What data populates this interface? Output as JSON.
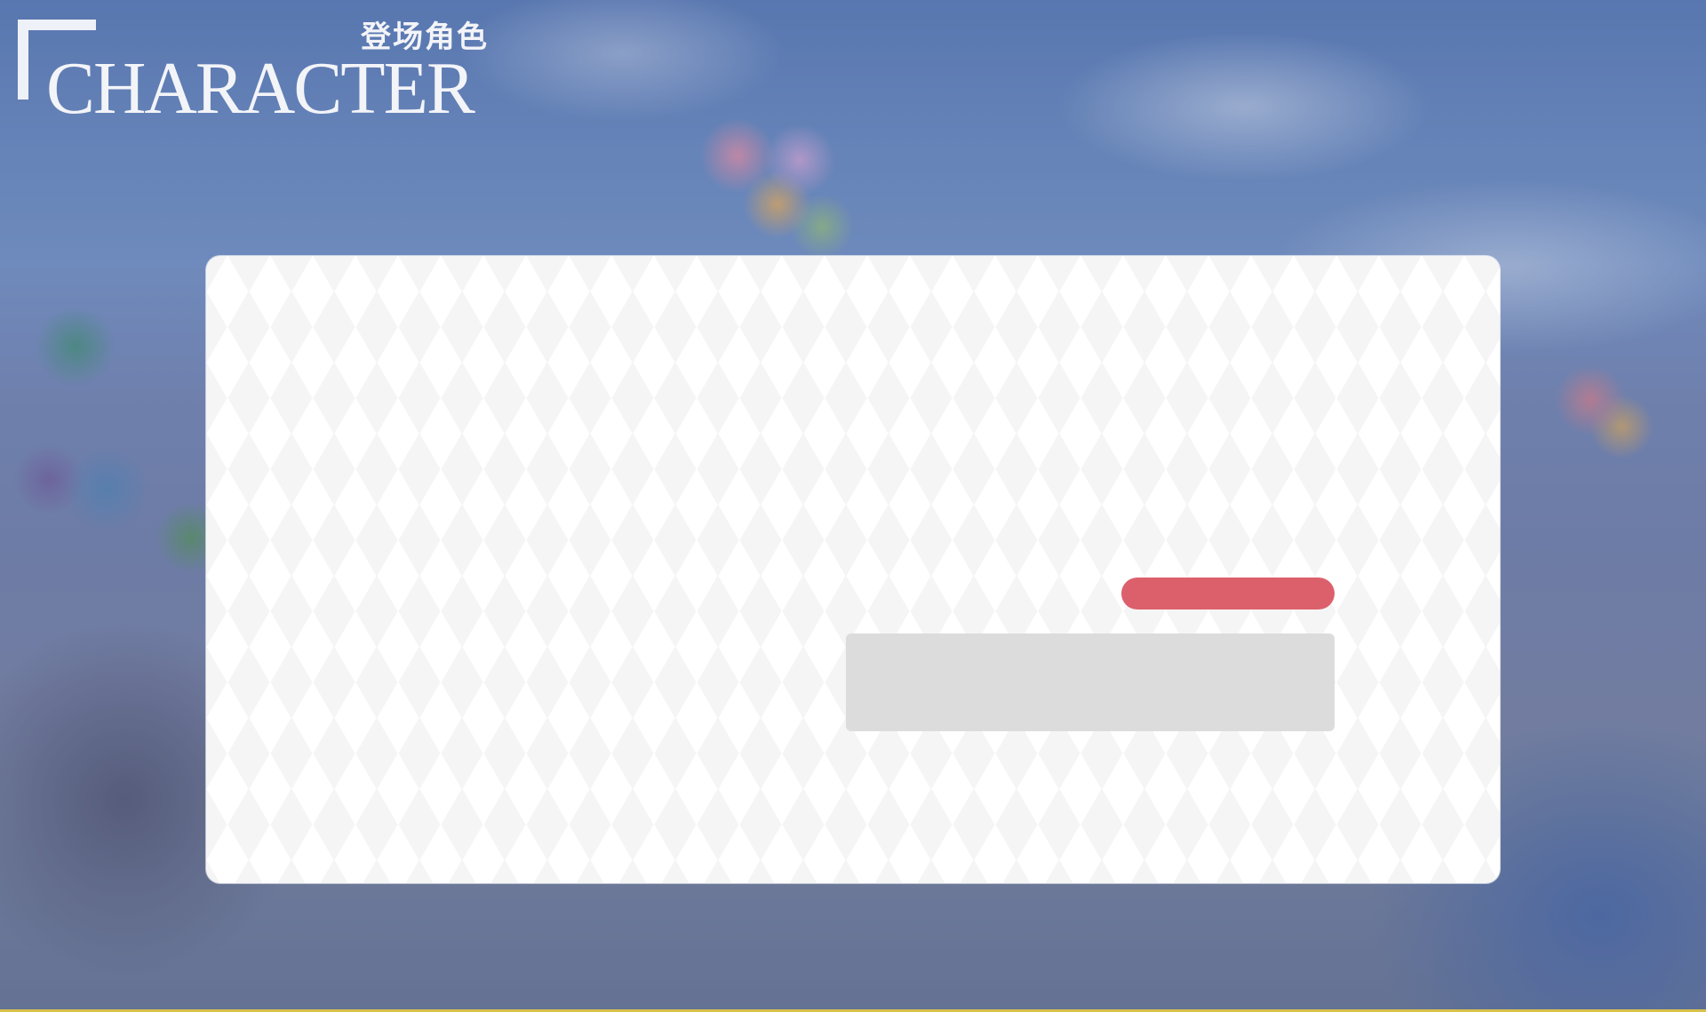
{
  "header": {
    "title": "CHARACTER",
    "subtitle": "登场角色"
  },
  "colors": {
    "accent": "#dc606c",
    "panel_background": "#ffffff",
    "pattern": "#f5f5f5",
    "placeholder_block": "#dcdcdc",
    "header_text": "#f3f4f8"
  },
  "panel": {
    "pill_bar_icon": "red-pill-bar",
    "content_block_icon": "gray-placeholder-block"
  }
}
